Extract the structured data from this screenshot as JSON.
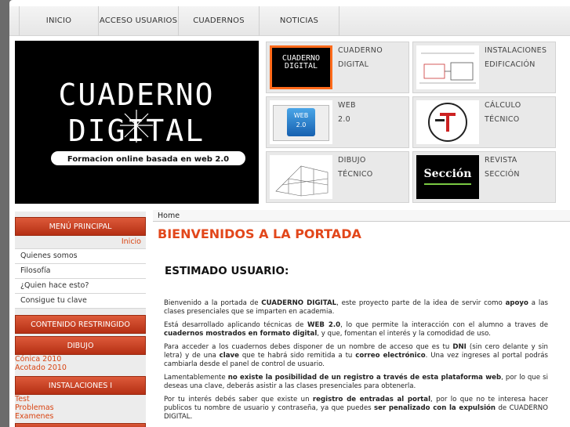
{
  "nav": [
    "INICIO",
    "ACCESO USUARIOS",
    "CUADERNOS",
    "NOTICIAS"
  ],
  "hero": {
    "line1": "CUADERNO",
    "line2": "DIGITAL",
    "tagline": "Formacion online basada en web 2.0"
  },
  "tiles": [
    {
      "l1": "CUADERNO",
      "l2": "DIGITAL",
      "thumb_text": "CUADERNO\nDIGITAL"
    },
    {
      "l1": "INSTALACIONES",
      "l2": "EDIFICACIÓN"
    },
    {
      "l1": "WEB",
      "l2": "2.0",
      "thumb_text": "WEB\n2.0"
    },
    {
      "l1": "CÁLCULO",
      "l2": "TÉCNICO"
    },
    {
      "l1": "DIBUJO",
      "l2": "TÉCNICO"
    },
    {
      "l1": "REVISTA",
      "l2": "SECCIÓN",
      "thumb_text": "Sección"
    }
  ],
  "sidebar": {
    "menu_title": "MENÚ PRINCIPAL",
    "inicio": "Inicio",
    "items": [
      "Quienes somos",
      "Filosofía",
      "¿Quien hace esto?",
      "Consigue tu clave"
    ],
    "restricted": "CONTENIDO RESTRINGIDO",
    "dibujo": "DIBUJO",
    "dibujo_links": [
      "Cónica 2010",
      "Acotado 2010"
    ],
    "instalaciones": "INSTALACIONES I",
    "inst_links": [
      "Test",
      "Problemas",
      "Examenes"
    ]
  },
  "main": {
    "breadcrumb": "Home",
    "title": "BIENVENIDOS A LA PORTADA",
    "subtitle": "ESTIMADO USUARIO:",
    "p1a": "Bienvenido a la portada de ",
    "p1b": "CUADERNO DIGITAL",
    "p1c": ", este proyecto parte de la idea de servir como ",
    "p1d": "apoyo",
    "p1e": " a las clases presenciales que se imparten en academia.",
    "p2a": "Está desarrollado aplicando técnicas de ",
    "p2b": "WEB 2.0",
    "p2c": ", lo que permite la interacción con el alumno a traves de ",
    "p2d": "cuadernos mostrados en formato digital",
    "p2e": ", y que, fomentan el interés y la comodidad de uso.",
    "p3a": "Para acceder a los cuadernos debes disponer de un nombre de acceso que es tu ",
    "p3b": "DNI",
    "p3c": " (sin cero delante y sin letra) y de una ",
    "p3d": "clave",
    "p3e": " que te habrá sido remitida a tu ",
    "p3f": "correo electrónico",
    "p3g": ". Una vez ingreses al portal podrás cambiarla desde el panel de control de usuario.",
    "p4a": "Lamentablemente ",
    "p4b": "no existe la posibilidad de un registro a través de esta plataforma web",
    "p4c": ", por lo que si deseas una clave, deberás asistir a las clases presenciales para obtenerla.",
    "p5a": "Por tu interés debés saber que existe un ",
    "p5b": "registro de entradas al portal",
    "p5c": ", por lo que no te interesa hacer publicos tu nombre de usuario y contraseña, ya que puedes ",
    "p5d": "ser penalizado con la expulsión",
    "p5e": " de CUADERNO DIGITAL."
  }
}
